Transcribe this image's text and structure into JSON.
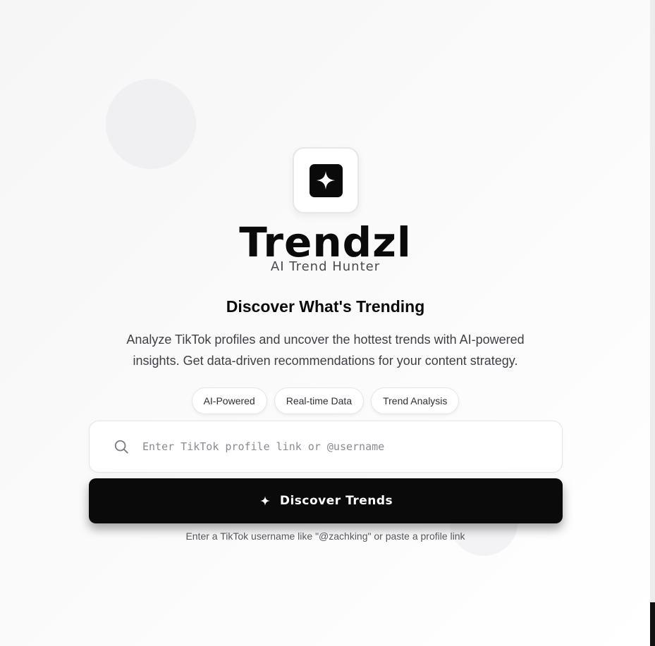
{
  "brand": {
    "name": "Trendzl",
    "tagline": "AI Trend Hunter",
    "logo_icon": "sparkle-icon"
  },
  "hero": {
    "headline": "Discover What's Trending",
    "description": "Analyze TikTok profiles and uncover the hottest trends with AI-powered insights. Get data-driven recommendations for your content strategy."
  },
  "features": [
    {
      "label": "AI-Powered"
    },
    {
      "label": "Real-time Data"
    },
    {
      "label": "Trend Analysis"
    }
  ],
  "search": {
    "placeholder": "Enter TikTok profile link or @username",
    "value": "",
    "icon": "search-icon"
  },
  "cta": {
    "label": "Discover Trends",
    "icon": "sparkle-icon"
  },
  "hint": "Enter a TikTok username like \"@zachking\" or paste a profile link",
  "colors": {
    "primary": "#0a0a0b",
    "background": "#f7f7f8",
    "text_muted": "#3f3f46"
  }
}
